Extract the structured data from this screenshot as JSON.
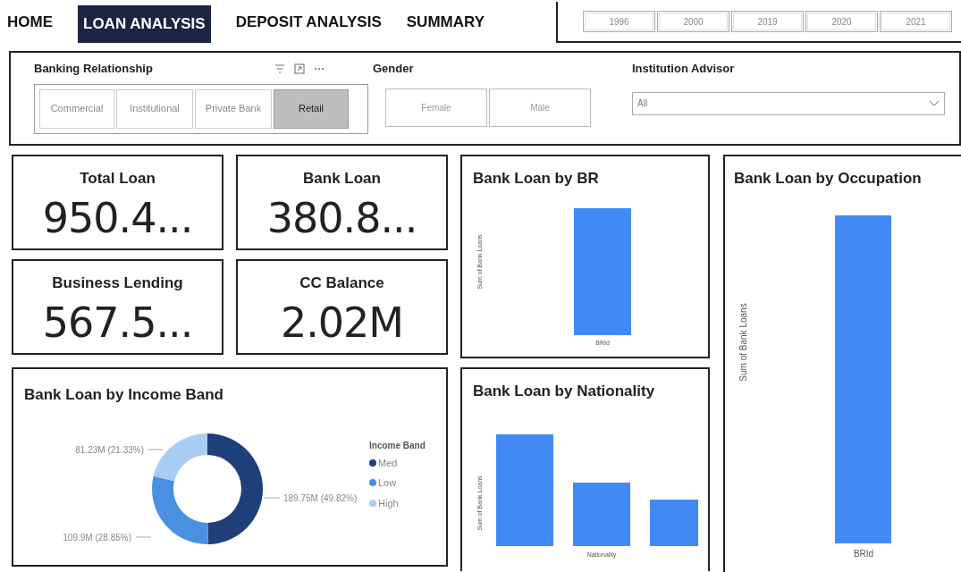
{
  "nav_tabs": [
    {
      "label": "HOME",
      "selected": false
    },
    {
      "label": "LOAN ANALYSIS",
      "selected": true
    },
    {
      "label": "DEPOSIT ANALYSIS",
      "selected": false
    },
    {
      "label": "SUMMARY",
      "selected": false
    }
  ],
  "year_slicer": [
    {
      "label": "1996",
      "selected": false
    },
    {
      "label": "2000",
      "selected": false
    },
    {
      "label": "2019",
      "selected": false
    },
    {
      "label": "2020",
      "selected": false
    },
    {
      "label": "2021",
      "selected": false
    }
  ],
  "filters": {
    "banking_relationship": {
      "title": "Banking Relationship",
      "options": [
        {
          "label": "Commercial",
          "selected": false
        },
        {
          "label": "Institutional",
          "selected": false
        },
        {
          "label": "Private Bank",
          "selected": false
        },
        {
          "label": "Retail",
          "selected": true
        }
      ]
    },
    "gender": {
      "title": "Gender",
      "options": [
        {
          "label": "Female",
          "selected": false
        },
        {
          "label": "Male",
          "selected": false
        }
      ]
    },
    "institution_advisor": {
      "title": "Institution Advisor",
      "value": "All"
    }
  },
  "kpis": [
    {
      "title": "Total Loan",
      "value": "950.4..."
    },
    {
      "title": "Bank Loan",
      "value": "380.8..."
    },
    {
      "title": "Business Lending",
      "value": "567.5..."
    },
    {
      "title": "CC Balance",
      "value": "2.02M"
    }
  ],
  "income_chart": {
    "title": "Bank Loan by Income Band",
    "legend": {
      "title": "Income Band",
      "items": [
        {
          "label": "Med",
          "color": "#1f3f7a"
        },
        {
          "label": "Low",
          "color": "#4a90e2"
        },
        {
          "label": "High",
          "color": "#a9cdf5"
        }
      ]
    },
    "chart_data": {
      "type": "donut",
      "values": [
        49.82,
        28.85,
        21.33
      ],
      "data_labels": true,
      "value_labels": [
        "189.75M (49.82%)",
        "109.9M (28.85%)",
        "81.23M (21.33%)"
      ]
    }
  },
  "br_chart": {
    "title": "Bank Loan by BR",
    "ylabel": "Sum of Bank Loans",
    "xlabel": "BRId"
  },
  "nationality_chart": {
    "title": "Bank Loan by Nationality",
    "ylabel": "Sum of Bank Loans",
    "xlabel": "Nationality"
  },
  "occupation_chart": {
    "title": "Bank Loan by Occupation",
    "ylabel": "Sum of Bank Loans",
    "xlabel": "BRId"
  }
}
